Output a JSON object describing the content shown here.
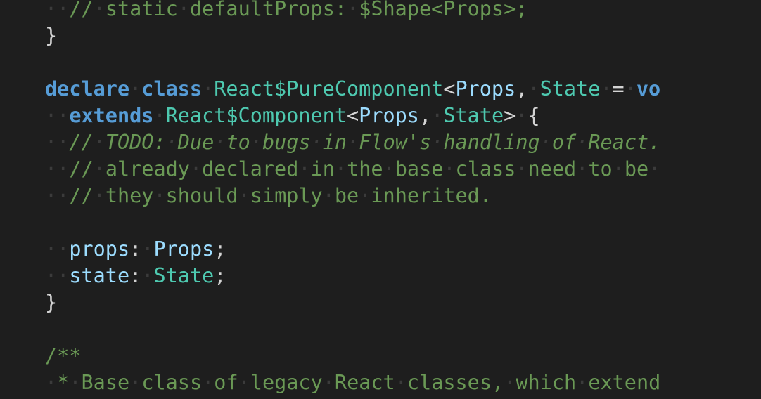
{
  "editor": {
    "theme": {
      "background": "#1e1e1e",
      "whitespace_dot": "#3b3b3b",
      "keyword": "#569cd6",
      "type": "#4ec9b0",
      "property": "#9cdcfe",
      "comment": "#6a9955",
      "punctuation": "#d4d4d4"
    },
    "render_whitespace": true,
    "lines": [
      [
        {
          "t": "ws",
          "v": "··"
        },
        {
          "t": "comment",
          "v": "//·static·defaultProps:·$Shape<Props>;"
        }
      ],
      [
        {
          "t": "brace",
          "v": "}"
        }
      ],
      [],
      [
        {
          "t": "kw",
          "v": "declare"
        },
        {
          "t": "ws",
          "v": "·"
        },
        {
          "t": "kw",
          "v": "class"
        },
        {
          "t": "ws",
          "v": "·"
        },
        {
          "t": "type",
          "v": "React$PureComponent"
        },
        {
          "t": "punct",
          "v": "<"
        },
        {
          "t": "prop",
          "v": "Props"
        },
        {
          "t": "punct",
          "v": ","
        },
        {
          "t": "ws",
          "v": "·"
        },
        {
          "t": "type",
          "v": "State"
        },
        {
          "t": "ws",
          "v": "·"
        },
        {
          "t": "punct",
          "v": "="
        },
        {
          "t": "ws",
          "v": "·"
        },
        {
          "t": "kw",
          "v": "vo"
        }
      ],
      [
        {
          "t": "ws",
          "v": "··"
        },
        {
          "t": "kw",
          "v": "extends"
        },
        {
          "t": "ws",
          "v": "·"
        },
        {
          "t": "type",
          "v": "React$Component"
        },
        {
          "t": "punct",
          "v": "<"
        },
        {
          "t": "prop",
          "v": "Props"
        },
        {
          "t": "punct",
          "v": ","
        },
        {
          "t": "ws",
          "v": "·"
        },
        {
          "t": "type",
          "v": "State"
        },
        {
          "t": "punct",
          "v": ">"
        },
        {
          "t": "ws",
          "v": "·"
        },
        {
          "t": "brace",
          "v": "{"
        }
      ],
      [
        {
          "t": "ws",
          "v": "··"
        },
        {
          "t": "comment-it",
          "v": "//·TODO:·Due·to·bugs·in·Flow's·handling·of·React."
        }
      ],
      [
        {
          "t": "ws",
          "v": "··"
        },
        {
          "t": "comment",
          "v": "//·already·declared·in·the·base·class·need·to·be·"
        }
      ],
      [
        {
          "t": "ws",
          "v": "··"
        },
        {
          "t": "comment",
          "v": "//·they·should·simply·be·inherited."
        }
      ],
      [],
      [
        {
          "t": "ws",
          "v": "··"
        },
        {
          "t": "prop",
          "v": "props"
        },
        {
          "t": "punct",
          "v": ":"
        },
        {
          "t": "ws",
          "v": "·"
        },
        {
          "t": "prop",
          "v": "Props"
        },
        {
          "t": "punct",
          "v": ";"
        }
      ],
      [
        {
          "t": "ws",
          "v": "··"
        },
        {
          "t": "prop",
          "v": "state"
        },
        {
          "t": "punct",
          "v": ":"
        },
        {
          "t": "ws",
          "v": "·"
        },
        {
          "t": "type",
          "v": "State"
        },
        {
          "t": "punct",
          "v": ";"
        }
      ],
      [
        {
          "t": "brace",
          "v": "}"
        }
      ],
      [],
      [
        {
          "t": "comment",
          "v": "/**"
        }
      ],
      [
        {
          "t": "comment",
          "v": "·*·Base·class·of·legacy·React·classes,·which·extend"
        }
      ]
    ]
  }
}
